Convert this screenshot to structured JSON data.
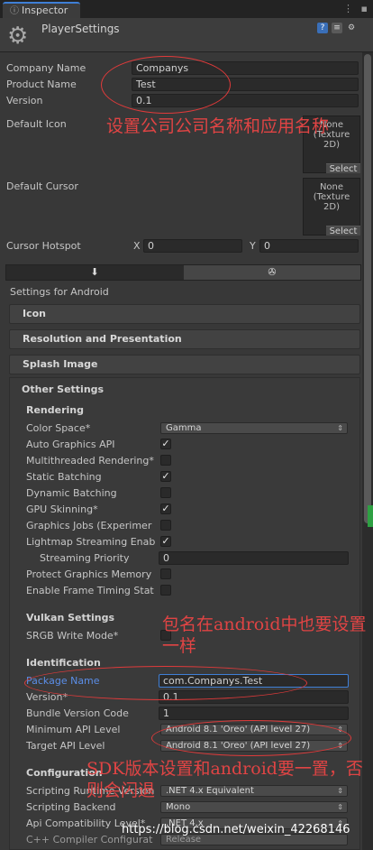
{
  "window": {
    "tab_label": "Inspector",
    "title": "PlayerSettings"
  },
  "fields": {
    "company_name_label": "Company Name",
    "company_name": "Companys",
    "product_name_label": "Product Name",
    "product_name": "Test",
    "version_label": "Version",
    "version": "0.1",
    "default_icon_label": "Default Icon",
    "default_cursor_label": "Default Cursor",
    "object_none": "None",
    "object_type": "(Texture 2D)",
    "select_label": "Select",
    "cursor_hotspot_label": "Cursor Hotspot",
    "hotspot_x_label": "X",
    "hotspot_x": "0",
    "hotspot_y_label": "Y",
    "hotspot_y": "0"
  },
  "platform": {
    "settings_for": "Settings for Android"
  },
  "sections": {
    "icon": "Icon",
    "resolution": "Resolution and Presentation",
    "splash": "Splash Image",
    "other": "Other Settings"
  },
  "rendering": {
    "header": "Rendering",
    "color_space_label": "Color Space*",
    "color_space": "Gamma",
    "auto_graphics_api": "Auto Graphics API",
    "multithreaded": "Multithreaded Rendering*",
    "static_batching": "Static Batching",
    "dynamic_batching": "Dynamic Batching",
    "gpu_skinning": "GPU Skinning*",
    "graphics_jobs": "Graphics Jobs (Experimer",
    "lightmap_streaming": "Lightmap Streaming Enab",
    "streaming_priority_label": "Streaming Priority",
    "streaming_priority": "0",
    "protect_graphics": "Protect Graphics Memory",
    "frame_timing": "Enable Frame Timing Stat"
  },
  "vulkan": {
    "header": "Vulkan Settings",
    "srgb": "SRGB Write Mode*"
  },
  "identification": {
    "header": "Identification",
    "package_name_label": "Package Name",
    "package_name": "com.Companys.Test",
    "version_label": "Version*",
    "version": "0.1",
    "bundle_code_label": "Bundle Version Code",
    "bundle_code": "1",
    "min_api_label": "Minimum API Level",
    "min_api": "Android 8.1 'Oreo' (API level 27)",
    "target_api_label": "Target API Level",
    "target_api": "Android 8.1 'Oreo' (API level 27)"
  },
  "configuration": {
    "header": "Configuration",
    "runtime_label": "Scripting Runtime Version",
    "runtime": ".NET 4.x Equivalent",
    "backend_label": "Scripting Backend",
    "backend": "Mono",
    "api_compat_label": "Api Compatibility Level*",
    "api_compat": ".NET 4.x",
    "cpp_label": "C++ Compiler Configurat",
    "cpp": "Release"
  },
  "annotations": {
    "company_note": "设置公司公司名称和应用名称",
    "package_note": "包名在android中也要设置一样",
    "sdk_note": "SDK版本设置和android要一置，否则会闪退"
  },
  "watermark": "https://blog.csdn.net/weixin_42268146",
  "colors": {
    "background": "#383838",
    "accent_blue": "#3f7fd6",
    "annotation_red": "#e04444",
    "link_blue": "#5b8ee8"
  }
}
